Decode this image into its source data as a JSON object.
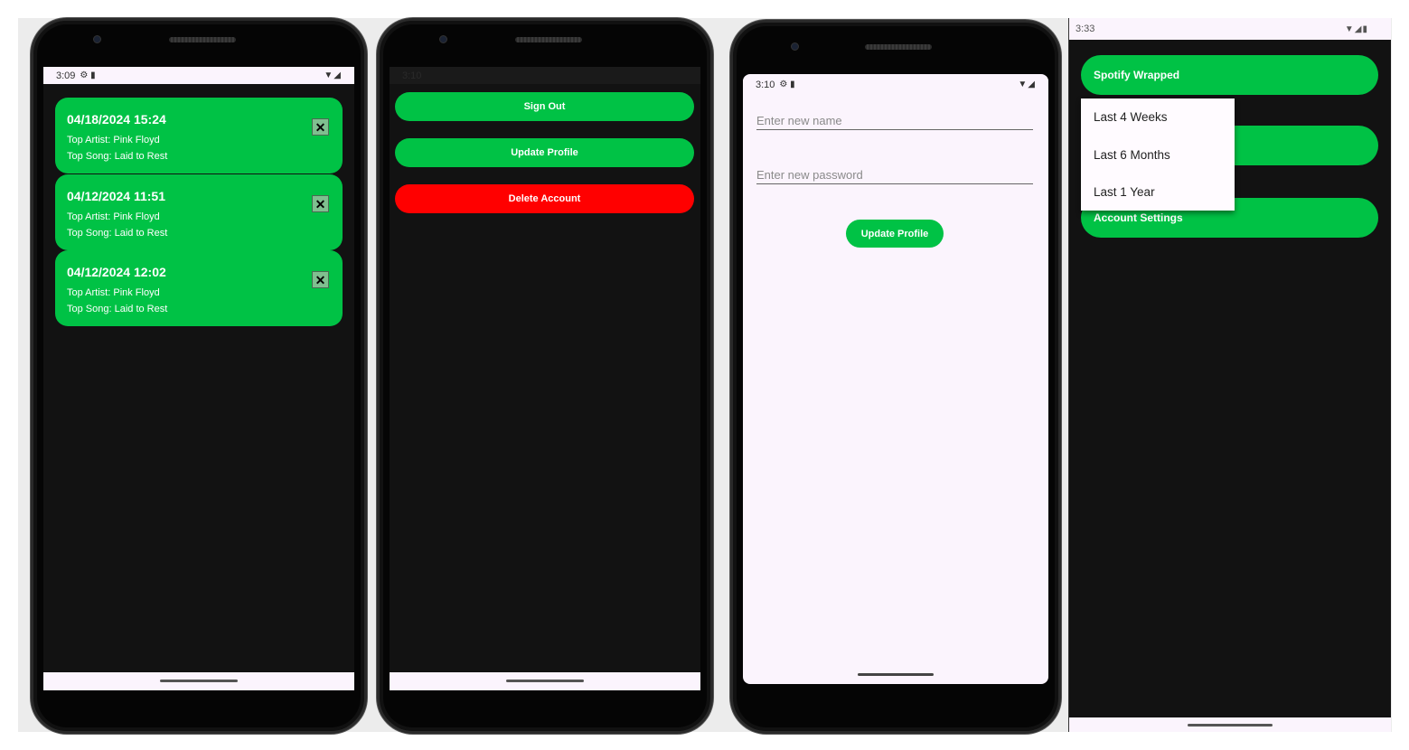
{
  "screen1": {
    "status_time": "3:09",
    "status_glyphs": "⚙ ▮",
    "status_right": "▼◢",
    "history": [
      {
        "date": "04/18/2024 15:24",
        "artist": "Top Artist: Pink Floyd",
        "song": "Top Song: Laid to Rest",
        "close": "✕"
      },
      {
        "date": "04/12/2024 11:51",
        "artist": "Top Artist: Pink Floyd",
        "song": "Top Song: Laid to Rest",
        "close": "✕"
      },
      {
        "date": "04/12/2024 12:02",
        "artist": "Top Artist: Pink Floyd",
        "song": "Top Song: Laid to Rest",
        "close": "✕"
      }
    ]
  },
  "screen2": {
    "status_time": "3:10",
    "sign_out": "Sign Out",
    "update_profile": "Update Profile",
    "delete_account": "Delete Account",
    "colors": {
      "green": "#00c245",
      "red": "#ff0000"
    }
  },
  "screen3": {
    "status_time": "3:10",
    "status_glyphs": "⚙ ▮",
    "status_right": "▼◢",
    "name_placeholder": "Enter new name",
    "password_placeholder": "Enter new password",
    "update_profile": "Update Profile"
  },
  "screen4": {
    "status_time": "3:33",
    "status_right": "▼◢▮",
    "spotify_wrapped": "Spotify Wrapped",
    "account_settings": "Account Settings",
    "dropdown": [
      "Last 4 Weeks",
      "Last 6 Months",
      "Last 1 Year"
    ]
  },
  "icons": {
    "settings": "gear-icon",
    "sd_card": "sd-card-icon",
    "wifi": "wifi-icon",
    "signal": "signal-icon",
    "battery": "battery-icon",
    "close": "close-icon"
  }
}
